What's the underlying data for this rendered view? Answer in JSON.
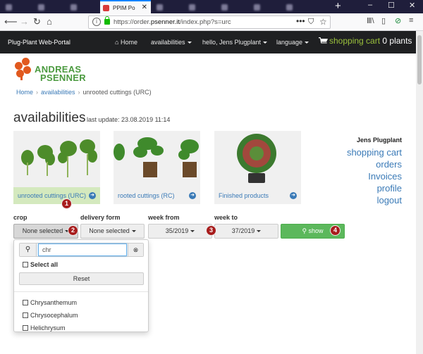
{
  "browser": {
    "tabs": [
      {
        "label": "PPIM Po",
        "active": true
      }
    ],
    "new_tab": "+",
    "url_prefix": "https://order.",
    "url_domain": "psenner.it",
    "url_path": "/index.php?s=urc",
    "window_controls": {
      "minimize": "–",
      "maximize": "☐",
      "close": "✕"
    }
  },
  "site": {
    "brand": "Plug-Plant Web-Portal",
    "nav": {
      "home": "Home",
      "availabilities": "availabilities",
      "user": "hello, Jens Plugplant",
      "language": "language"
    },
    "cart": {
      "label": "shopping cart",
      "count": "0 plants"
    }
  },
  "logo": {
    "line1": "ANDREAS",
    "line2": "PSENNER"
  },
  "breadcrumb": {
    "home": "Home",
    "availabilities": "availabilities",
    "current": "unrooted cuttings (URC)"
  },
  "page": {
    "title": "availabilities",
    "last_update": "last update: 23.08.2019 11:14"
  },
  "cards": [
    {
      "label": "unrooted cuttings (URC)",
      "selected": true
    },
    {
      "label": "rooted cuttings (RC)",
      "selected": false
    },
    {
      "label": "Finished products",
      "selected": false
    }
  ],
  "sidebar": {
    "user": "Jens Plugplant",
    "links": [
      "shopping cart",
      "orders",
      "Invoices",
      "profile",
      "logout"
    ]
  },
  "filters": {
    "crop": {
      "label": "crop",
      "value": "None selected"
    },
    "delivery_form": {
      "label": "delivery form",
      "value": "None selected"
    },
    "week_from": {
      "label": "week from",
      "value": "35/2019"
    },
    "week_to": {
      "label": "week to",
      "value": "37/2019"
    },
    "show": "show"
  },
  "markers": [
    "1",
    "2",
    "3",
    "4"
  ],
  "dropdown": {
    "search_value": "chr",
    "select_all": "Select all",
    "reset": "Reset",
    "options": [
      "Chrysanthemum",
      "Chrysocephalum",
      "Helichrysum"
    ]
  },
  "colors": {
    "accent_green": "#5cb85c",
    "link_blue": "#3a7ab7",
    "marker_red": "#a81d1d",
    "logo_orange": "#e1591e",
    "logo_green": "#4b9a3f"
  }
}
